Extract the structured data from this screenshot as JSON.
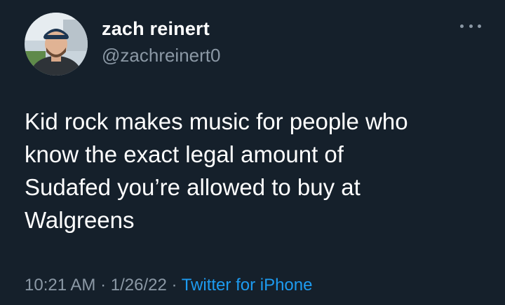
{
  "tweet": {
    "display_name": "zach reinert",
    "handle": "@zachreinert0",
    "text": "Kid rock makes music for people who\nknow the exact legal amount of\nSudafed you’re allowed to buy at\nWalgreens",
    "time": "10:21 AM",
    "separator": " · ",
    "date": "1/26/22",
    "source": "Twitter for iPhone",
    "more_icon": "more-horizontal-icon"
  },
  "colors": {
    "background": "#15202b",
    "primary_text": "#ffffff",
    "secondary_text": "#8b98a5",
    "accent": "#1d9bf0"
  }
}
